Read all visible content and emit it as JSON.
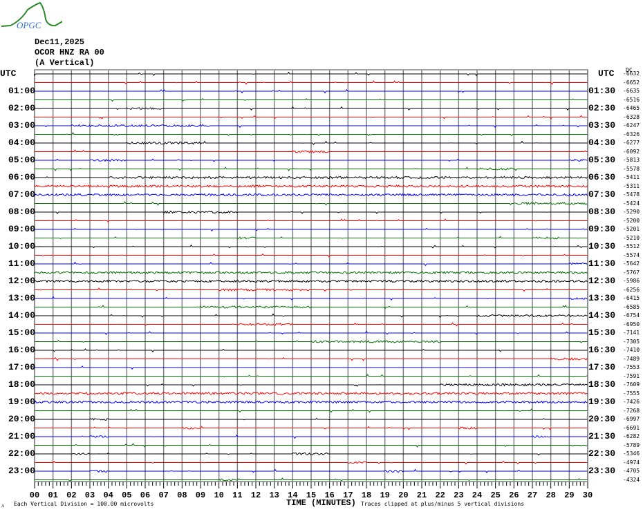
{
  "logo_text": "OPGC",
  "header": {
    "date": "Dec11,2025",
    "station": "OCOR HNZ RA 00",
    "component": "(A Vertical)"
  },
  "chart_data": {
    "type": "line",
    "title": "Helicorder OCOR HNZ RA 00",
    "left_axis_title": "UTC",
    "right_axis_title": "UTC",
    "right_corner_label": "DC",
    "left_labels": [
      "01:00",
      "02:00",
      "03:00",
      "04:00",
      "05:00",
      "06:00",
      "07:00",
      "08:00",
      "09:00",
      "10:00",
      "11:00",
      "12:00",
      "13:00",
      "14:00",
      "15:00",
      "16:00",
      "17:00",
      "18:00",
      "19:00",
      "20:00",
      "21:00",
      "22:00",
      "23:00"
    ],
    "right_labels": [
      "01:30",
      "02:30",
      "03:30",
      "04:30",
      "05:30",
      "06:30",
      "07:30",
      "08:30",
      "09:30",
      "10:30",
      "11:30",
      "12:30",
      "13:30",
      "14:30",
      "15:30",
      "16:30",
      "17:30",
      "18:30",
      "19:30",
      "20:30",
      "21:30",
      "22:30",
      "23:30"
    ],
    "dc_offsets": [
      "-6632",
      "-6652",
      "-6635",
      "-6516",
      "-6465",
      "-6328",
      "-6247",
      "-6326",
      "-6277",
      "-6092",
      "-5813",
      "-5578",
      "-5411",
      "-5311",
      "-5478",
      "-5424",
      "-5290",
      "-5200",
      "-5201",
      "-5210",
      "-5512",
      "-5574",
      "-5642",
      "-5767",
      "-5986",
      "-6256",
      "-6415",
      "-6585",
      "-6754",
      "-6950",
      "-7141",
      "-7305",
      "-7410",
      "-7489",
      "-7553",
      "-7591",
      "-7609",
      "-7555",
      "-7426",
      "-7268",
      "-6997",
      "-6691",
      "-6282",
      "-5789",
      "-5346",
      "-4974",
      "-4705",
      "-4324"
    ],
    "trace_colors": [
      "#000000",
      "#ff0000",
      "#0000ff",
      "#007000"
    ],
    "x_ticks": [
      "00",
      "01",
      "02",
      "03",
      "04",
      "05",
      "06",
      "07",
      "08",
      "09",
      "10",
      "11",
      "12",
      "13",
      "14",
      "15",
      "16",
      "17",
      "18",
      "19",
      "20",
      "21",
      "22",
      "23",
      "24",
      "25",
      "26",
      "27",
      "28",
      "29",
      "30"
    ],
    "xlabel": "TIME (MINUTES)",
    "xlim": [
      0,
      30
    ],
    "grid": "vertical",
    "scale_note": "Each Vertical Division =  100.00 microvolts",
    "clip_note": "Traces clipped at plus/minus 5 vertical divisions"
  }
}
